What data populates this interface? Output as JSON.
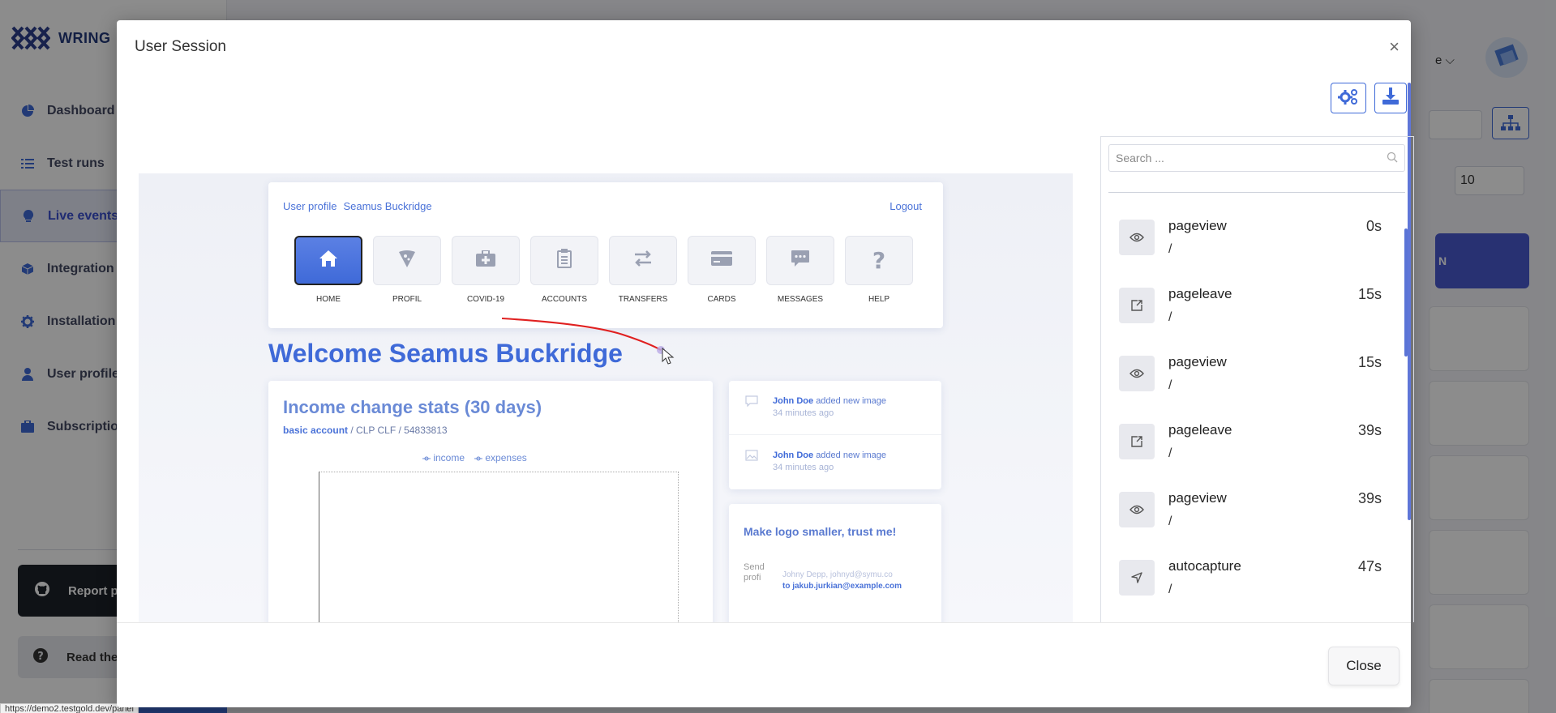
{
  "app": {
    "brand": "WRING",
    "nav": [
      {
        "label": "Dashboard",
        "icon": "pie-chart-icon"
      },
      {
        "label": "Test runs",
        "icon": "list-icon"
      },
      {
        "label": "Live events",
        "icon": "lightbulb-icon",
        "active": true
      },
      {
        "label": "Integration",
        "icon": "cube-icon"
      },
      {
        "label": "Installation",
        "icon": "gear-icon"
      },
      {
        "label": "User profile",
        "icon": "user-icon"
      },
      {
        "label": "Subscription",
        "icon": "briefcase-icon"
      }
    ],
    "report_label": "Report p",
    "docs_label": "Read the",
    "status_url": "https://demo2.testgold.dev/panel",
    "right_select_value": "10",
    "right_partial_e": "e",
    "right_button_partial": "N"
  },
  "modal": {
    "title": "User Session",
    "close_x": "×",
    "close_label": "Close",
    "settings_icon": "gears-icon",
    "download_icon": "download-icon"
  },
  "replay": {
    "user_alt": "User profile",
    "user_name": "Seamus Buckridge",
    "logout": "Logout",
    "tiles": [
      {
        "label": "HOME",
        "icon": "home-icon",
        "active": true
      },
      {
        "label": "PROFIL",
        "icon": "pizza-icon"
      },
      {
        "label": "COVID-19",
        "icon": "medkit-icon"
      },
      {
        "label": "ACCOUNTS",
        "icon": "clipboard-icon"
      },
      {
        "label": "TRANSFERS",
        "icon": "transfer-icon"
      },
      {
        "label": "CARDS",
        "icon": "card-icon"
      },
      {
        "label": "MESSAGES",
        "icon": "chat-icon"
      },
      {
        "label": "HELP",
        "icon": "question-icon"
      }
    ],
    "welcome": "Welcome Seamus Buckridge",
    "stats_title": "Income change stats (30 days)",
    "stats_account": "basic account",
    "stats_account_rest": " / CLP CLF / 54833813",
    "legend_income": "income",
    "legend_expenses": "expenses",
    "activity": [
      {
        "who": "John Doe",
        "action": "added new image",
        "time": "34 minutes ago"
      },
      {
        "who": "John Doe",
        "action": "added new image",
        "time": "34 minutes ago"
      }
    ],
    "message_title": "Make logo smaller, trust me!",
    "message_avatar_alt": "Send profi",
    "message_from": "Johny Depp, johnyd@symu.co",
    "message_to": "to jakub.jurkian@example.com"
  },
  "events": {
    "search_placeholder": "Search ...",
    "items": [
      {
        "name": "pageview",
        "path": "/",
        "time": "0s",
        "icon": "eye-icon"
      },
      {
        "name": "pageleave",
        "path": "/",
        "time": "15s",
        "icon": "exit-page-icon"
      },
      {
        "name": "pageview",
        "path": "/",
        "time": "15s",
        "icon": "eye-icon"
      },
      {
        "name": "pageleave",
        "path": "/",
        "time": "39s",
        "icon": "exit-page-icon"
      },
      {
        "name": "pageview",
        "path": "/",
        "time": "39s",
        "icon": "eye-icon"
      },
      {
        "name": "autocapture",
        "path": "/",
        "time": "47s",
        "icon": "cursor-arrow-icon"
      }
    ]
  }
}
